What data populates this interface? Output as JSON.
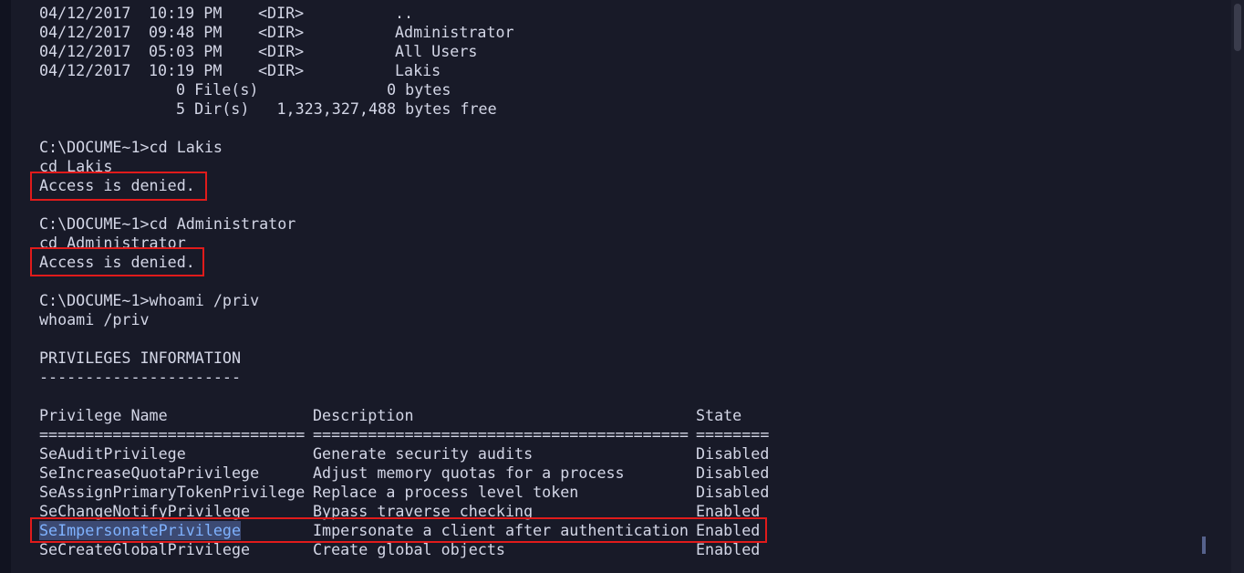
{
  "dir_listing": {
    "entries": [
      {
        "date": "04/12/2017",
        "time": "10:19 PM",
        "type": "<DIR>",
        "name": ".."
      },
      {
        "date": "04/12/2017",
        "time": "09:48 PM",
        "type": "<DIR>",
        "name": "Administrator"
      },
      {
        "date": "04/12/2017",
        "time": "05:03 PM",
        "type": "<DIR>",
        "name": "All Users"
      },
      {
        "date": "04/12/2017",
        "time": "10:19 PM",
        "type": "<DIR>",
        "name": "Lakis"
      }
    ],
    "files_summary": "0 File(s)              0 bytes",
    "dirs_summary": "5 Dir(s)   1,323,327,488 bytes free"
  },
  "session": {
    "cmd1_prompt": "C:\\DOCUME~1>cd Lakis",
    "cmd1_echo": "cd Lakis",
    "cmd1_output": "Access is denied.",
    "cmd2_prompt": "C:\\DOCUME~1>cd Administrator",
    "cmd2_echo": "cd Administrator",
    "cmd2_output": "Access is denied.",
    "cmd3_prompt": "C:\\DOCUME~1>whoami /priv",
    "cmd3_echo": "whoami /priv"
  },
  "privileges": {
    "section_title": "PRIVILEGES INFORMATION",
    "section_underline": "----------------------",
    "headers": {
      "name": "Privilege Name",
      "description": "Description",
      "state": "State"
    },
    "separators": {
      "name": "=============================",
      "description": "=========================================",
      "state": "========"
    },
    "rows": [
      {
        "name": "SeAuditPrivilege",
        "description": "Generate security audits",
        "state": "Disabled"
      },
      {
        "name": "SeIncreaseQuotaPrivilege",
        "description": "Adjust memory quotas for a process",
        "state": "Disabled"
      },
      {
        "name": "SeAssignPrimaryTokenPrivilege",
        "description": "Replace a process level token",
        "state": "Disabled"
      },
      {
        "name": "SeChangeNotifyPrivilege",
        "description": "Bypass traverse checking",
        "state": "Enabled"
      },
      {
        "name": "SeImpersonatePrivilege",
        "description": "Impersonate a client after authentication",
        "state": "Enabled"
      },
      {
        "name": "SeCreateGlobalPrivilege",
        "description": "Create global objects",
        "state": "Enabled"
      }
    ]
  },
  "colors": {
    "background": "#181a28",
    "text": "#d3d6e6",
    "highlight_border": "#e01b1b",
    "selection_text": "#7fb2ff"
  }
}
